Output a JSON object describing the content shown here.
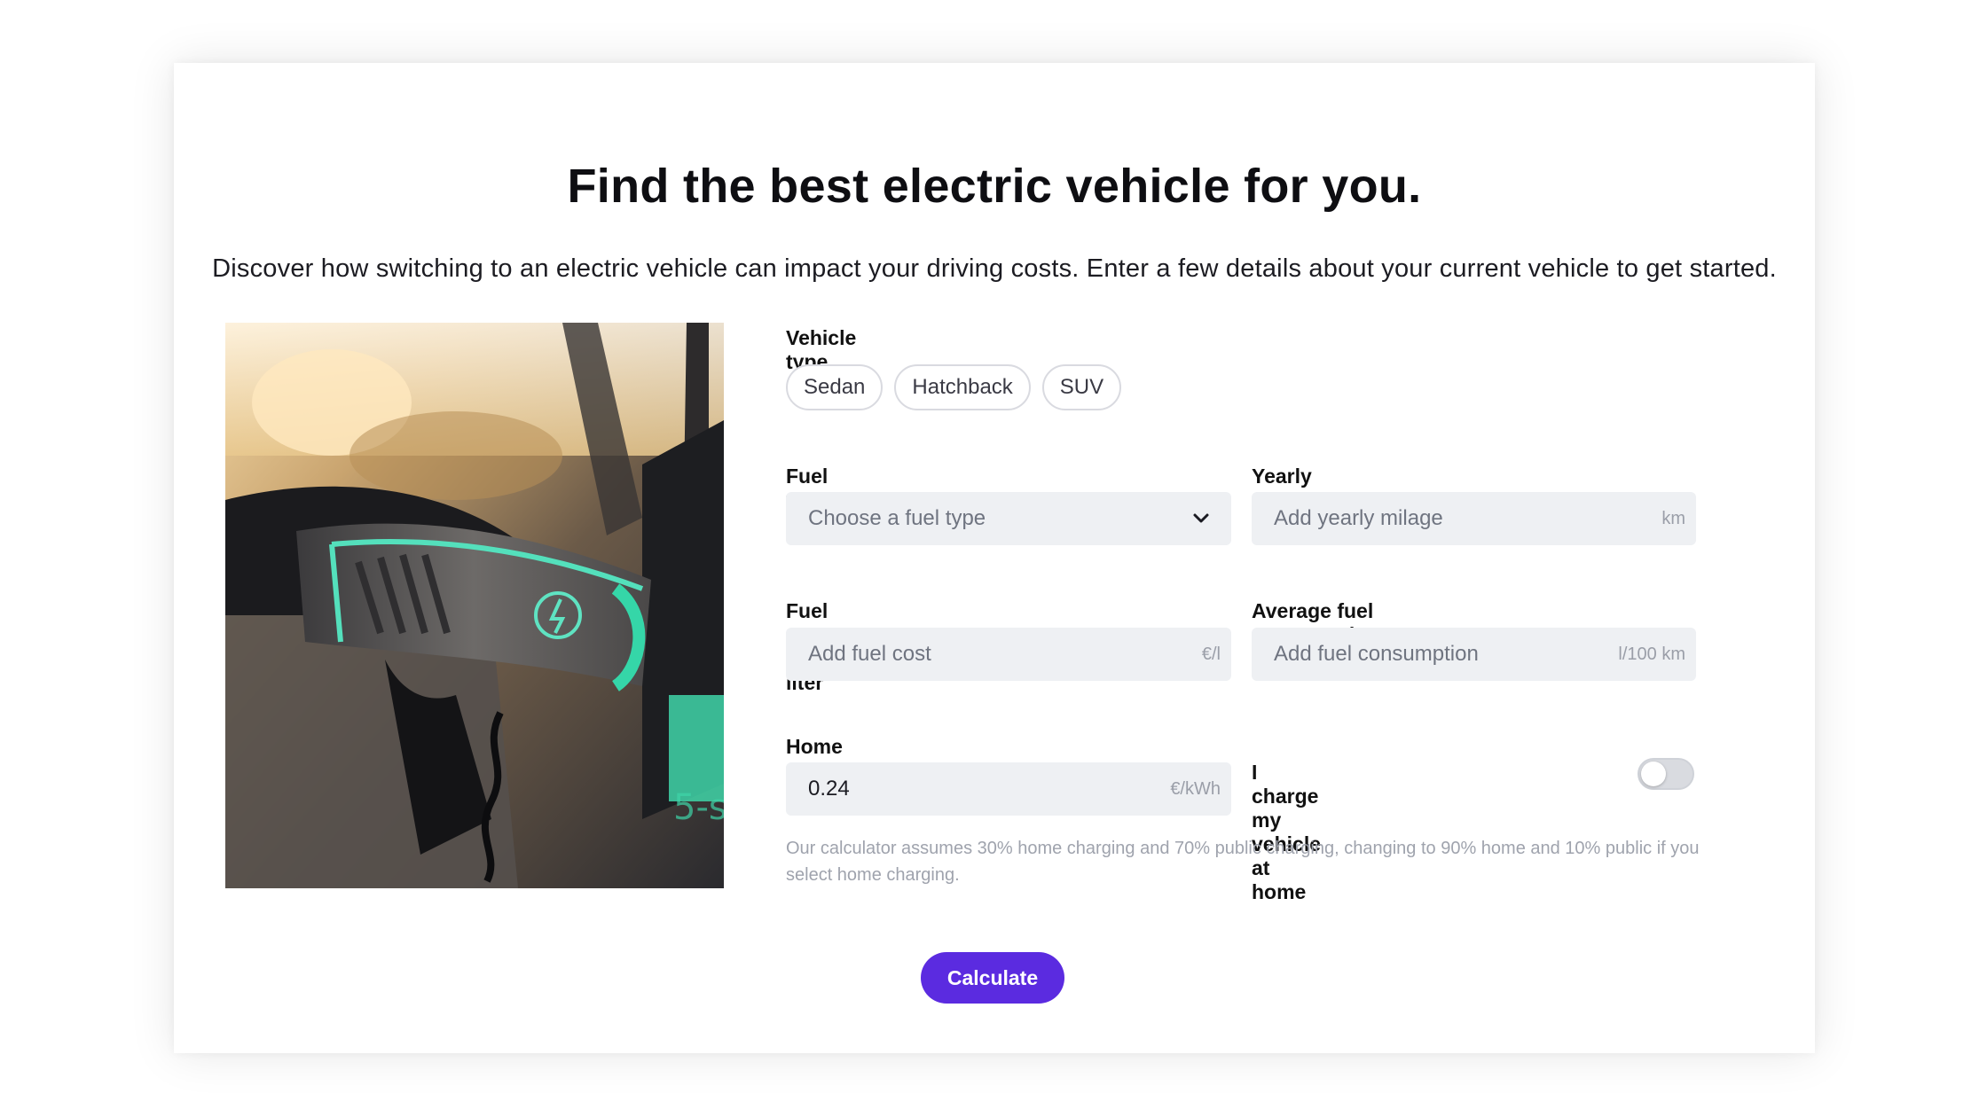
{
  "header": {
    "title": "Find the best electric vehicle for you.",
    "subtitle": "Discover how switching to an electric vehicle can impact your driving costs. Enter a few details about your current vehicle to get started."
  },
  "image": {
    "description_icon": "ev-charging-plug-photo"
  },
  "form": {
    "vehicle_type": {
      "label": "Vehicle type",
      "options": [
        "Sedan",
        "Hatchback",
        "SUV"
      ]
    },
    "fuel_type": {
      "label": "Fuel type",
      "placeholder": "Choose a fuel type",
      "icon": "chevron-down-icon"
    },
    "yearly_mileage": {
      "label": "Yearly mileage",
      "placeholder": "Add yearly milage",
      "unit": "km"
    },
    "fuel_cost": {
      "label": "Fuel cost per liter",
      "placeholder": "Add fuel cost",
      "unit": "€/l"
    },
    "avg_consumption": {
      "label": "Average fuel consumption",
      "placeholder": "Add fuel consumption",
      "unit": "l/100 km"
    },
    "home_charging_price": {
      "label": "Home charging price",
      "value": "0.24",
      "unit": "€/kWh"
    },
    "home_charging_toggle": {
      "label": "I charge my vehicle at home",
      "on": false
    },
    "note": "Our calculator assumes 30% home charging and 70% public charging, changing to 90% home and 10% public if you select home charging."
  },
  "actions": {
    "calculate_label": "Calculate"
  },
  "colors": {
    "accent": "#5b2be0",
    "field_bg": "#eef0f3",
    "chip_border": "#d9dae0"
  }
}
